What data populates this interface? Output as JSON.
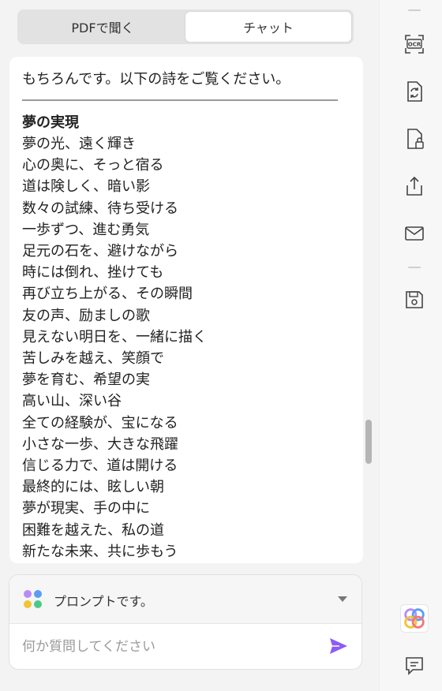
{
  "tabs": [
    {
      "label": "PDFで聞く"
    },
    {
      "label": "チャット"
    }
  ],
  "chat": {
    "intro": "もちろんです。以下の詩をご覧ください。",
    "poem_title": "夢の実現",
    "poem_lines": [
      "夢の光、遠く輝き",
      "心の奥に、そっと宿る",
      "道は険しく、暗い影",
      "数々の試練、待ち受ける",
      "一歩ずつ、進む勇気",
      "足元の石を、避けながら",
      "時には倒れ、挫けても",
      "再び立ち上がる、その瞬間",
      "友の声、励ましの歌",
      "見えない明日を、一緒に描く",
      "苦しみを越え、笑顔で",
      "夢を育む、希望の実",
      "高い山、深い谷",
      "全ての経験が、宝になる",
      "小さな一歩、大きな飛躍",
      "信じる力で、道は開ける",
      "最終的には、眩しい朝",
      "夢が現実、手の中に",
      "困難を越えた、私の道",
      "新たな未来、共に歩もう"
    ]
  },
  "prompt": {
    "selector_label": "プロンプトです。",
    "input_placeholder": "何か質問してください"
  },
  "sidebar": {
    "icons": [
      "ocr-icon",
      "convert-icon",
      "lock-file-icon",
      "share-icon",
      "mail-icon",
      "save-icon",
      "brand-logo-icon",
      "comment-icon"
    ],
    "ocr_text": "OCR"
  },
  "colors": {
    "accent": "#8b5cf6",
    "dot_purple": "#b98af7",
    "dot_blue": "#5b9cf6",
    "dot_yellow": "#f4c430",
    "dot_green": "#4cc98a"
  }
}
